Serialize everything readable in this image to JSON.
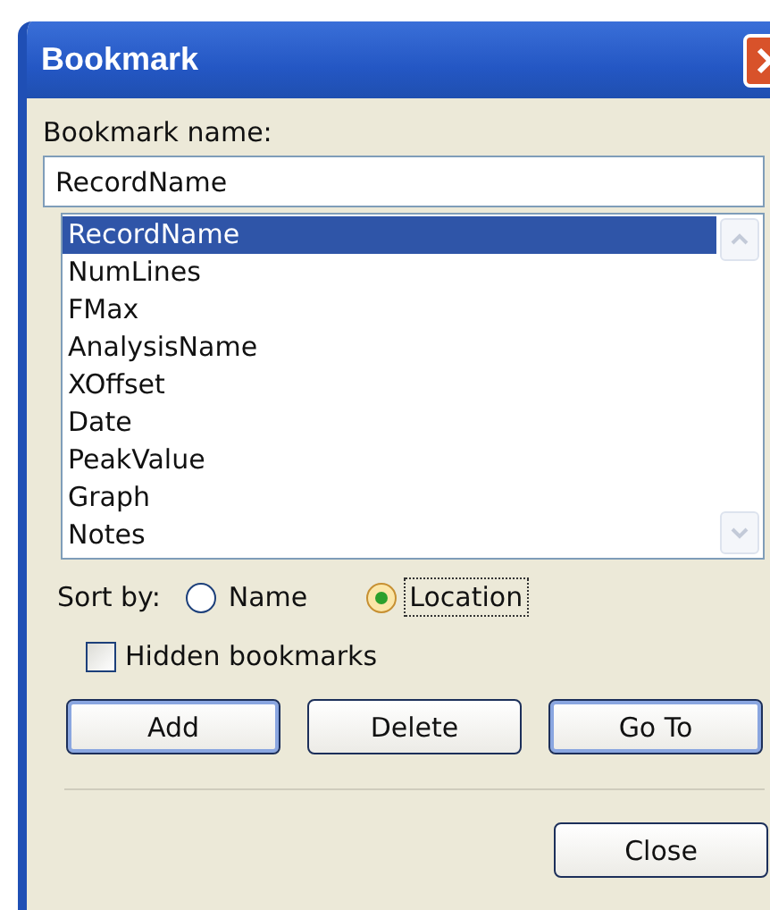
{
  "window": {
    "title": "Bookmark"
  },
  "name_label": "Bookmark name:",
  "name_field": {
    "value": "RecordName"
  },
  "bookmarks": [
    {
      "label": "RecordName",
      "selected": true
    },
    {
      "label": "NumLines",
      "selected": false
    },
    {
      "label": "FMax",
      "selected": false
    },
    {
      "label": "AnalysisName",
      "selected": false
    },
    {
      "label": "XOffset",
      "selected": false
    },
    {
      "label": "Date",
      "selected": false
    },
    {
      "label": "PeakValue",
      "selected": false
    },
    {
      "label": "Graph",
      "selected": false
    },
    {
      "label": "Notes",
      "selected": false
    }
  ],
  "sort_by": {
    "label": "Sort by:",
    "options": [
      {
        "label": "Name",
        "selected": false,
        "focused": false
      },
      {
        "label": "Location",
        "selected": true,
        "focused": true
      }
    ]
  },
  "hidden_bookmarks": {
    "label": "Hidden bookmarks",
    "checked": false
  },
  "buttons": [
    {
      "label": "Add",
      "default": true
    },
    {
      "label": "Delete",
      "default": false
    },
    {
      "label": "Go To",
      "default": true
    }
  ],
  "close_button": {
    "label": "Close",
    "default": false
  }
}
